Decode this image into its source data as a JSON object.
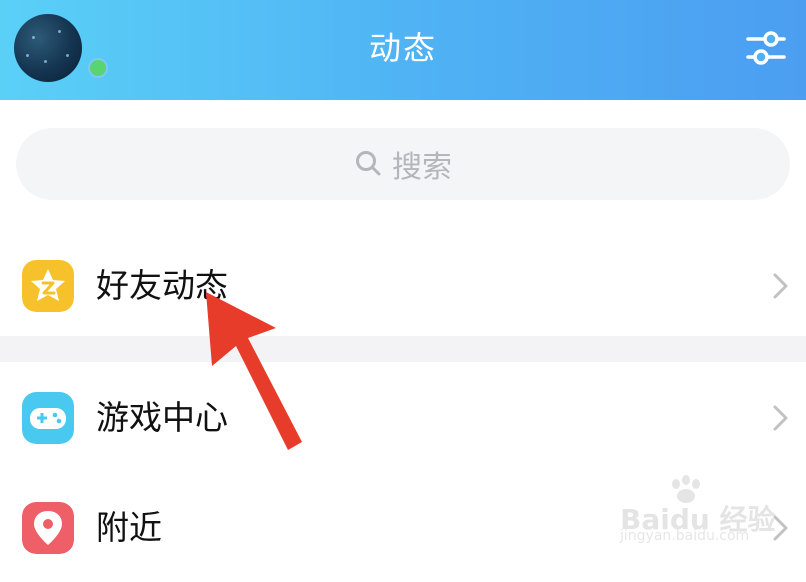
{
  "header": {
    "title": "动态",
    "background_colors": [
      "#5ad0f7",
      "#4c9ef1"
    ],
    "online_status_color": "#58d470"
  },
  "search": {
    "placeholder": "搜索",
    "icon": "search-icon"
  },
  "menu": [
    {
      "label": "好友动态",
      "icon": "friends-feed-star-icon",
      "icon_color": "#f7c12b"
    },
    {
      "label": "游戏中心",
      "icon": "gamepad-icon",
      "icon_color": "#49c8f0"
    },
    {
      "label": "附近",
      "icon": "location-pin-icon",
      "icon_color": "#ef5f67"
    }
  ],
  "annotation": {
    "type": "arrow",
    "color": "#e83c2b",
    "points_to": "好友动态"
  },
  "watermark": {
    "text": "Baidu 经验",
    "url": "jingyan.baidu.com"
  }
}
